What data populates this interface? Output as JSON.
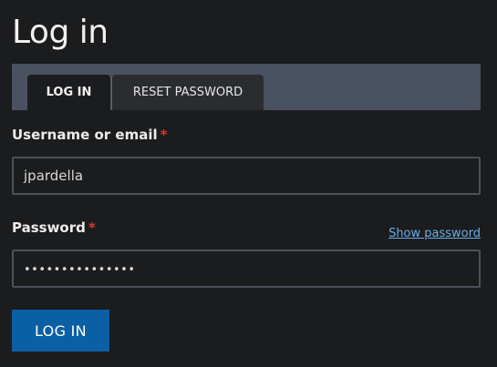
{
  "page": {
    "title": "Log in"
  },
  "tabs": [
    {
      "label": "LOG IN",
      "active": true
    },
    {
      "label": "RESET PASSWORD",
      "active": false
    }
  ],
  "form": {
    "username": {
      "label": "Username or email",
      "required_marker": "*",
      "value": "jpardella"
    },
    "password": {
      "label": "Password",
      "required_marker": "*",
      "masked_value": "•••••••••••••••",
      "show_password_label": "Show password"
    },
    "submit_label": "LOG IN"
  },
  "colors": {
    "background": "#1b1c1e",
    "tab_bar": "#4a5160",
    "required": "#e0352b",
    "link": "#6aaee6",
    "primary_button": "#0b5fa5"
  }
}
